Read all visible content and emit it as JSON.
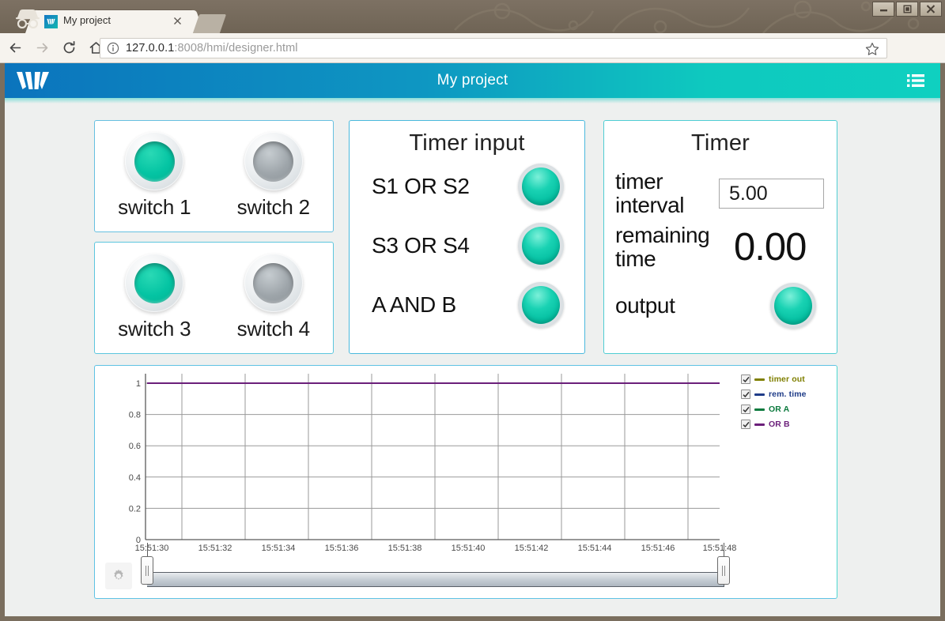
{
  "browser": {
    "tab_title": "My project",
    "tab_favicon_icon": "w-logo-icon",
    "close_icon": "close-icon",
    "new_tab_icon": "new-tab-icon",
    "incognito_icon": "incognito-icon",
    "back_icon": "back-arrow-icon",
    "forward_icon": "forward-arrow-icon",
    "reload_icon": "reload-icon",
    "home_icon": "home-icon",
    "info_icon": "info-circle-icon",
    "star_icon": "star-icon",
    "extension_icon": "extension-badge-icon",
    "menu_icon": "three-dot-menu-icon",
    "url_host": "127.0.0.1",
    "url_rest": ":8008/hmi/designer.html",
    "url_full": "127.0.0.1:8008/hmi/designer.html",
    "minimize_label": "minimize",
    "maximize_label": "maximize",
    "close_label": "close"
  },
  "app": {
    "title": "My project",
    "logo_icon": "w-logo-icon",
    "menu_icon": "hamburger-list-icon",
    "gradient_start": "#0b74bd",
    "gradient_end": "#0fd0c0"
  },
  "switch_panel_a": {
    "switches": [
      {
        "label": "switch 1",
        "state": "on"
      },
      {
        "label": "switch 2",
        "state": "off"
      }
    ]
  },
  "switch_panel_b": {
    "switches": [
      {
        "label": "switch 3",
        "state": "on"
      },
      {
        "label": "switch 4",
        "state": "off"
      }
    ]
  },
  "timer_input_panel": {
    "title": "Timer input",
    "rows": [
      {
        "label": "S1 OR S2",
        "state": "on"
      },
      {
        "label": "S3 OR S4",
        "state": "on"
      },
      {
        "label": "A AND B",
        "state": "on"
      }
    ]
  },
  "timer_panel": {
    "title": "Timer",
    "interval_label": "timer interval",
    "interval_value": "5.00",
    "remaining_label": "remaining time",
    "remaining_value": "0.00",
    "output_label": "output",
    "output_state": "on"
  },
  "chart_data": {
    "type": "line",
    "title": "",
    "xlabel": "",
    "ylabel": "",
    "grid": true,
    "legend_position": "right",
    "ylim": [
      0,
      1
    ],
    "yticks": [
      "0",
      "0.2",
      "0.4",
      "0.6",
      "0.8",
      "1"
    ],
    "ytick_values": [
      0,
      0.2,
      0.4,
      0.6,
      0.8,
      1
    ],
    "xticks": [
      "15:51:30",
      "15:51:32",
      "15:51:34",
      "15:51:36",
      "15:51:38",
      "15:51:40",
      "15:51:42",
      "15:51:44",
      "15:51:46",
      "15:51:48"
    ],
    "x": [
      "15:51:30",
      "15:51:32",
      "15:51:34",
      "15:51:36",
      "15:51:38",
      "15:51:40",
      "15:51:42",
      "15:51:44",
      "15:51:46",
      "15:51:48"
    ],
    "series": [
      {
        "name": "timer out",
        "color": "#7f7f00",
        "checked": true,
        "values": [
          1,
          1,
          1,
          1,
          1,
          1,
          1,
          1,
          1,
          1
        ]
      },
      {
        "name": "rem. time",
        "color": "#1f3c88",
        "checked": true,
        "values": [
          1,
          1,
          1,
          1,
          1,
          1,
          1,
          1,
          1,
          1
        ]
      },
      {
        "name": "OR A",
        "color": "#0c7a3e",
        "checked": true,
        "values": [
          1,
          1,
          1,
          1,
          1,
          1,
          1,
          1,
          1,
          1
        ]
      },
      {
        "name": "OR B",
        "color": "#6b1f7a",
        "checked": true,
        "values": [
          1,
          1,
          1,
          1,
          1,
          1,
          1,
          1,
          1,
          1
        ]
      }
    ]
  },
  "chart_controls": {
    "settings_icon": "gear-icon",
    "range_left_handle": "range-slider-left-handle",
    "range_right_handle": "range-slider-right-handle",
    "range_start_percent": 0,
    "range_end_percent": 100
  }
}
